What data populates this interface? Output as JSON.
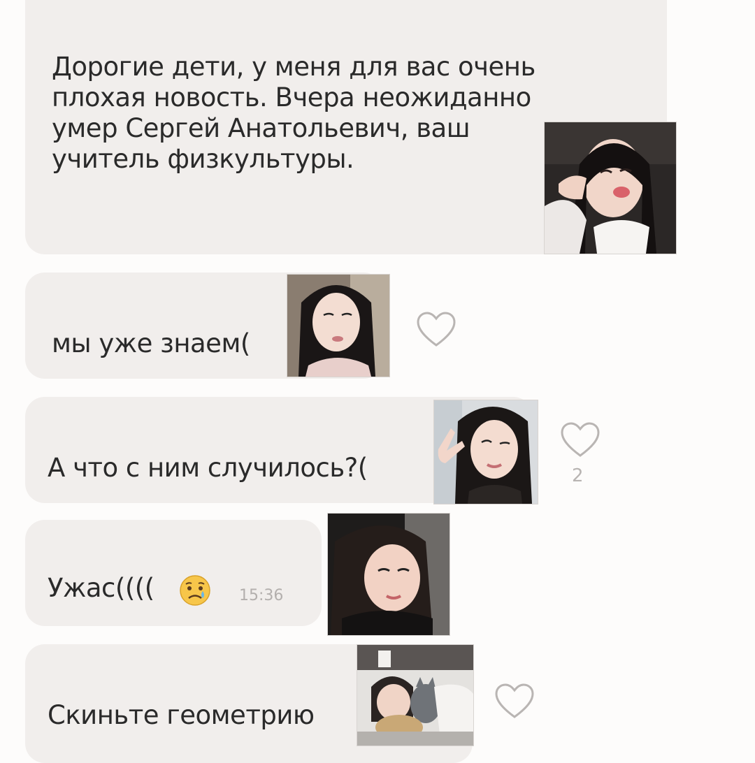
{
  "messages": [
    {
      "text": "Дорогие дети, у меня для вас очень\nплохая новость. Вчера неожиданно\nумер Сергей Анатольевич, ваш\nучитель физкультуры.",
      "avatar": "teacher-avatar"
    },
    {
      "text": "мы уже знаем(",
      "avatar": "student-avatar-1",
      "like_icon": "heart-outline-icon"
    },
    {
      "text": "А что с ним случилось?(",
      "avatar": "student-avatar-2",
      "like_icon": "heart-outline-icon",
      "like_count": "2"
    },
    {
      "text": "Ужас((((",
      "emoji": "sad-tear-face-emoji",
      "time": "15:36",
      "avatar": "student-avatar-3"
    },
    {
      "text": "Скиньте геометрию",
      "avatar": "student-avatar-4",
      "like_icon": "heart-outline-icon"
    }
  ],
  "colors": {
    "background": "#fdfcfb",
    "bubble": "#f1eeec",
    "text": "#2a2a2a",
    "heart_stroke": "#b9b5b3"
  }
}
